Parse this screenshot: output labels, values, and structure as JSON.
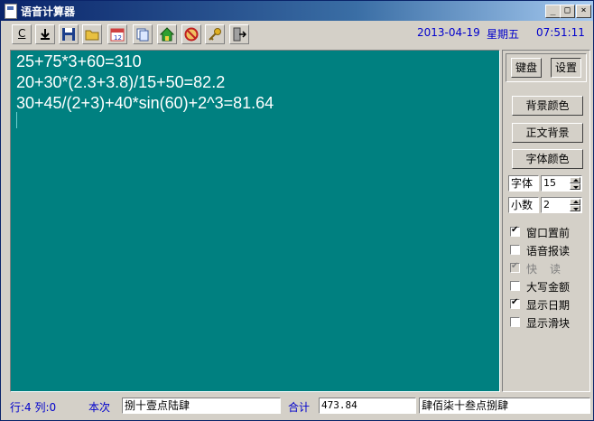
{
  "window": {
    "title": "语音计算器"
  },
  "titlebar_buttons": [
    "_",
    "□",
    "×"
  ],
  "toolbar": {
    "tools": [
      {
        "icon": "clear-icon",
        "glyph": "C"
      },
      {
        "icon": "download-icon"
      },
      {
        "icon": "save-icon"
      },
      {
        "icon": "open-folder-icon"
      },
      {
        "icon": "calendar-icon"
      },
      {
        "icon": "copy-icon"
      },
      {
        "icon": "home-icon"
      },
      {
        "icon": "mute-icon"
      },
      {
        "icon": "key-icon"
      },
      {
        "icon": "exit-icon"
      }
    ],
    "date": "2013-04-19",
    "weekday": "星期五",
    "time": "07:51:11"
  },
  "editor": {
    "lines": [
      "25+75*3+60=310",
      "20+30*(2.3+3.8)/15+50=82.2",
      "30+45/(2+3)+40*sin(60)+2^3=81.64"
    ],
    "background": "#008080"
  },
  "panel": {
    "tabs": [
      "键盘",
      "设置"
    ],
    "active_tab": 1,
    "buttons": [
      "背景颜色",
      "正文背景",
      "字体颜色"
    ],
    "font_label": "字体",
    "font_value": "15",
    "decimal_label": "小数",
    "decimal_value": "2",
    "checkboxes": [
      {
        "label": "窗口置前",
        "checked": true,
        "disabled": false
      },
      {
        "label": "语音报读",
        "checked": false,
        "disabled": false
      },
      {
        "label": "快读",
        "checked": true,
        "disabled": true
      },
      {
        "label": "大写金额",
        "checked": false,
        "disabled": false
      },
      {
        "label": "显示日期",
        "checked": true,
        "disabled": false
      },
      {
        "label": "显示滑块",
        "checked": false,
        "disabled": false
      }
    ]
  },
  "status": {
    "position": "行:4 列:0",
    "current_label": "本次",
    "current_value": "捌十壹点陆肆",
    "total_label": "合计",
    "total_value": "473.84",
    "total_words": "肆佰柒十叁点捌肆"
  }
}
